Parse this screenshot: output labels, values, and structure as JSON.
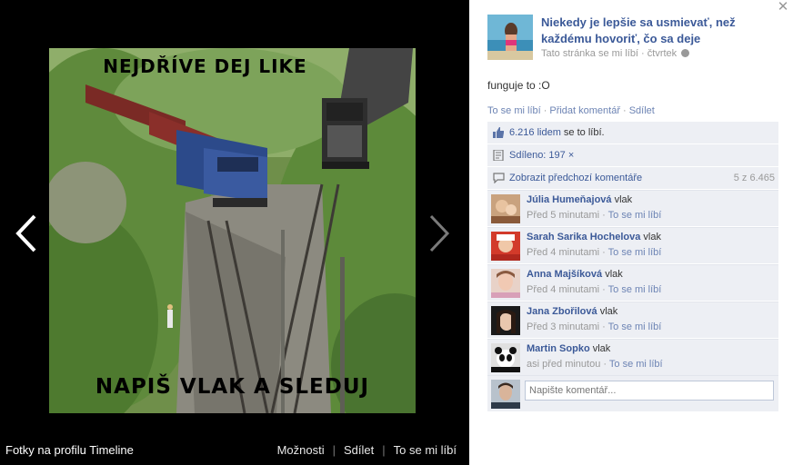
{
  "photo": {
    "top_text": "NEJDŘÍVE DEJ LIKE",
    "bottom_text": "NAPIŠ VLAK A SLEDUJ"
  },
  "footer": {
    "album_title": "Fotky na profilu Timeline",
    "options_label": "Možnosti",
    "share_label": "Sdílet",
    "like_label": "To se mi líbí"
  },
  "post": {
    "page_name": "Niekedy je lepšie sa usmievať, než každému hovoriť, čo sa deje",
    "page_liked": "Tato stránka se mi líbí",
    "meta_sep": " · ",
    "date": "čtvrtek",
    "caption": "funguje to :O",
    "actions": {
      "like": "To se mi líbí",
      "comment": "Přidat komentář",
      "share": "Sdílet"
    },
    "likes": {
      "count_link": "6.216 lidem",
      "suffix": " se to líbí."
    },
    "shares": {
      "link": "Sdíleno: 197 ×"
    },
    "previous_comments": {
      "link": "Zobrazit předchozí komentáře",
      "count": "5 z 6.465"
    }
  },
  "comments": [
    {
      "author": "Júlia Humeňajová",
      "text": "vlak",
      "time": "Před 5 minutami",
      "like": "To se mi líbí"
    },
    {
      "author": "Sarah Sarika Hochelova",
      "text": "vlak",
      "time": "Před 4 minutami",
      "like": "To se mi líbí"
    },
    {
      "author": "Anna Majšíková",
      "text": "vlak",
      "time": "Před 4 minutami",
      "like": "To se mi líbí"
    },
    {
      "author": "Jana Zbořilová",
      "text": "vlak",
      "time": "Před 3 minutami",
      "like": "To se mi líbí"
    },
    {
      "author": "Martin Sopko",
      "text": "vlak",
      "time": "asi před minutou",
      "like": "To se mi líbí"
    }
  ],
  "composer": {
    "placeholder": "Napište komentář..."
  },
  "colors": {
    "link": "#3b5998",
    "muted_link": "#6d84b4",
    "ufi_bg": "#edeff4",
    "stage_bg": "#000000"
  }
}
